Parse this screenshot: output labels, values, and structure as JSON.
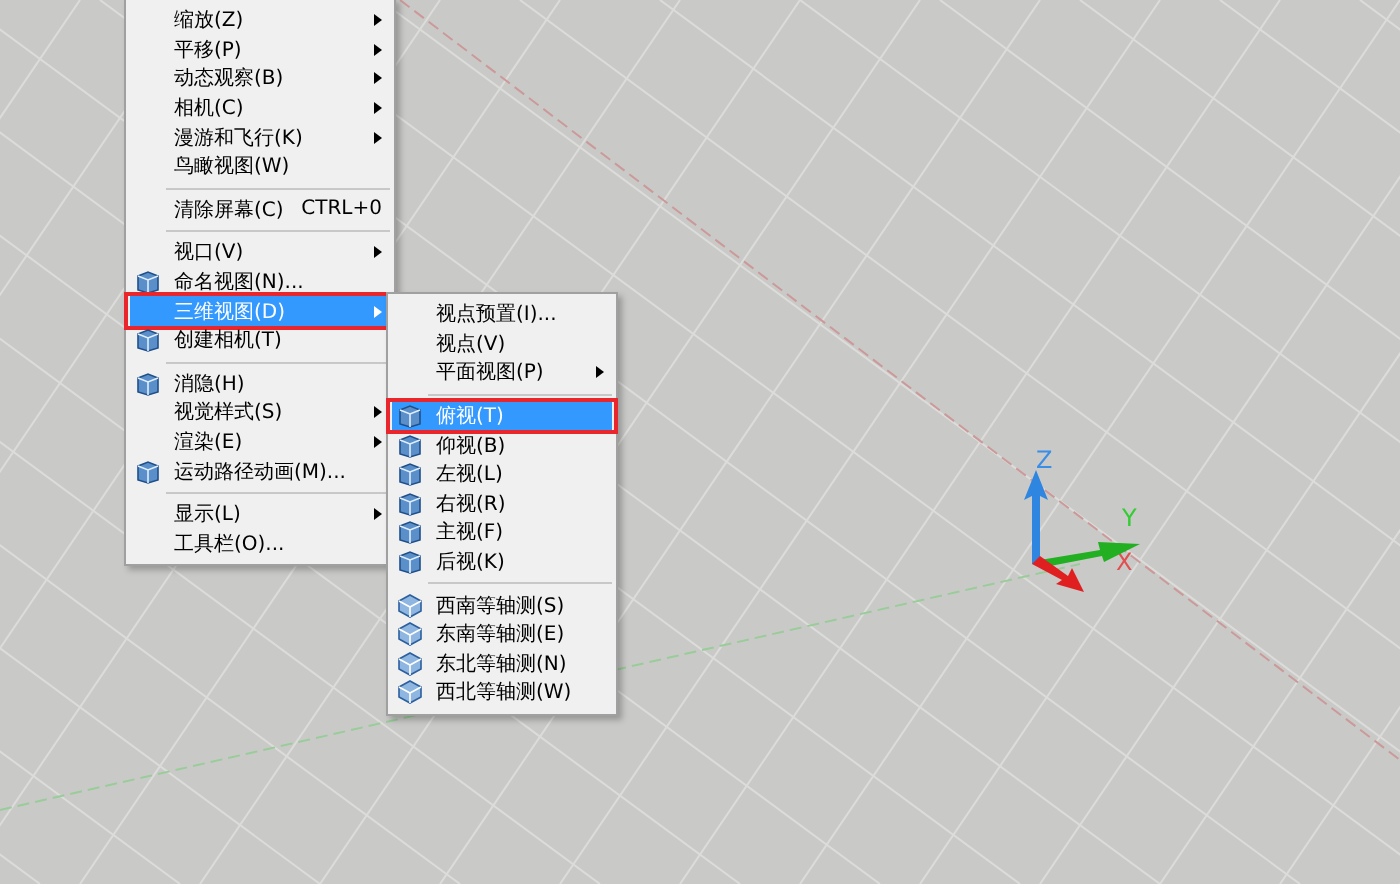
{
  "main_menu": {
    "items": [
      {
        "kind": "text",
        "label": "缩放(Z)",
        "submenu": true,
        "selected": false
      },
      {
        "kind": "text",
        "label": "平移(P)",
        "submenu": true,
        "selected": false
      },
      {
        "kind": "text",
        "label": "动态观察(B)",
        "submenu": true,
        "selected": false
      },
      {
        "kind": "text",
        "label": "相机(C)",
        "submenu": true,
        "selected": false
      },
      {
        "kind": "text",
        "label": "漫游和飞行(K)",
        "submenu": true,
        "selected": false
      },
      {
        "kind": "text",
        "label": "鸟瞰视图(W)",
        "submenu": false,
        "selected": false
      },
      {
        "kind": "separator"
      },
      {
        "kind": "text",
        "label": "清除屏幕(C)",
        "shortcut": "CTRL+0",
        "submenu": false,
        "selected": false
      },
      {
        "kind": "separator"
      },
      {
        "kind": "text",
        "label": "视口(V)",
        "submenu": true,
        "selected": false
      },
      {
        "kind": "icon",
        "label": "命名视图(N)...",
        "submenu": false,
        "selected": false
      },
      {
        "kind": "text",
        "label": "三维视图(D)",
        "submenu": true,
        "selected": true,
        "marked": true
      },
      {
        "kind": "icon",
        "label": "创建相机(T)",
        "submenu": false,
        "selected": false
      },
      {
        "kind": "separator"
      },
      {
        "kind": "icon",
        "label": "消隐(H)",
        "submenu": false,
        "selected": false
      },
      {
        "kind": "text",
        "label": "视觉样式(S)",
        "submenu": true,
        "selected": false
      },
      {
        "kind": "text",
        "label": "渲染(E)",
        "submenu": true,
        "selected": false
      },
      {
        "kind": "icon",
        "label": "运动路径动画(M)...",
        "submenu": false,
        "selected": false
      },
      {
        "kind": "separator"
      },
      {
        "kind": "text",
        "label": "显示(L)",
        "submenu": true,
        "selected": false
      },
      {
        "kind": "text",
        "label": "工具栏(O)...",
        "submenu": false,
        "selected": false
      }
    ]
  },
  "submenu": {
    "items": [
      {
        "kind": "text",
        "label": "视点预置(I)...",
        "submenu": false,
        "selected": false
      },
      {
        "kind": "text",
        "label": "视点(V)",
        "submenu": false,
        "selected": false
      },
      {
        "kind": "text",
        "label": "平面视图(P)",
        "submenu": true,
        "selected": false
      },
      {
        "kind": "separator"
      },
      {
        "kind": "icon",
        "label": "俯视(T)",
        "submenu": false,
        "selected": true,
        "marked": true
      },
      {
        "kind": "icon",
        "label": "仰视(B)",
        "submenu": false,
        "selected": false
      },
      {
        "kind": "icon",
        "label": "左视(L)",
        "submenu": false,
        "selected": false
      },
      {
        "kind": "icon",
        "label": "右视(R)",
        "submenu": false,
        "selected": false
      },
      {
        "kind": "icon",
        "label": "主视(F)",
        "submenu": false,
        "selected": false
      },
      {
        "kind": "icon",
        "label": "后视(K)",
        "submenu": false,
        "selected": false
      },
      {
        "kind": "separator"
      },
      {
        "kind": "iso",
        "label": "西南等轴测(S)",
        "submenu": false,
        "selected": false
      },
      {
        "kind": "iso",
        "label": "东南等轴测(E)",
        "submenu": false,
        "selected": false
      },
      {
        "kind": "iso",
        "label": "东北等轴测(N)",
        "submenu": false,
        "selected": false
      },
      {
        "kind": "iso",
        "label": "西北等轴测(W)",
        "submenu": false,
        "selected": false
      }
    ]
  },
  "ucs": {
    "z_label": "Z",
    "y_label": "Y",
    "x_label": "X"
  }
}
